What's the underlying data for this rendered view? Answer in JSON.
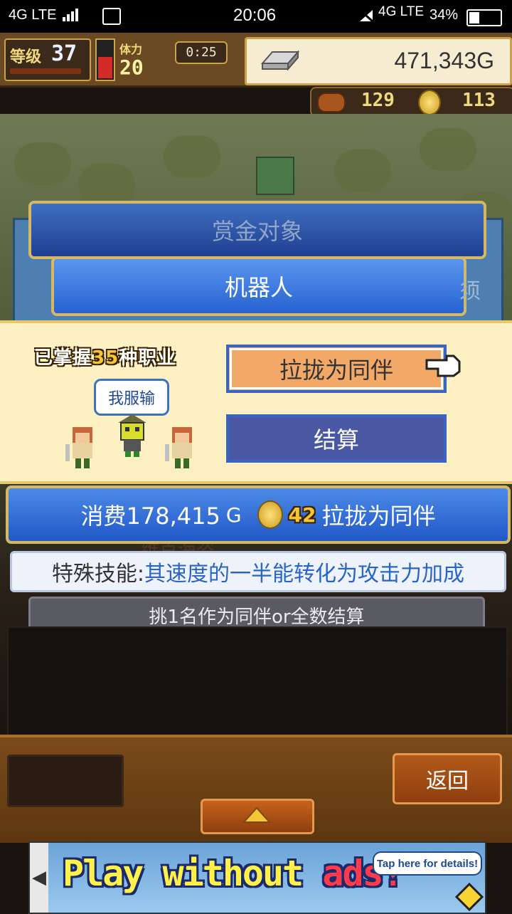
{
  "status_bar": {
    "left_network": "4G LTE",
    "time": "20:06",
    "right_network": "4G LTE",
    "battery": "34%"
  },
  "header": {
    "level_label": "等级",
    "level": "37",
    "stamina_label": "体力",
    "stamina": "20",
    "timer": "0:25",
    "gold": "471,343G"
  },
  "resources": {
    "medals": "129",
    "coins": "113"
  },
  "dialog": {
    "title": "赏金对象",
    "target": "机器人",
    "side_char": "须"
  },
  "panel": {
    "mastered_prefix": "已掌握",
    "mastered_count": "35",
    "mastered_suffix": "种职业",
    "speech": "我服输",
    "recruit_label": "拉拢为同伴",
    "settle_label": "结算"
  },
  "cost": {
    "prefix": "消费178,415",
    "unit": "G",
    "coins": "42",
    "action": "拉拢为同伴"
  },
  "behind_text": "维克海盗",
  "skill": {
    "label": "特殊技能:",
    "text": "其速度的一半能转化为攻击力加成"
  },
  "info": "挑1名作为同伴or全数结算",
  "bottom": {
    "back_label": "返回"
  },
  "ad": {
    "text_main": "Play without ",
    "text_red": "ads!",
    "tap": "Tap here for details!"
  },
  "colors": {
    "panel_bg": "#fdf1c4",
    "recruit_btn": "#f2a867",
    "settle_btn": "#4a57a2",
    "cost_bar": "#2f6fd8",
    "skill_text": "#2a64c8"
  }
}
